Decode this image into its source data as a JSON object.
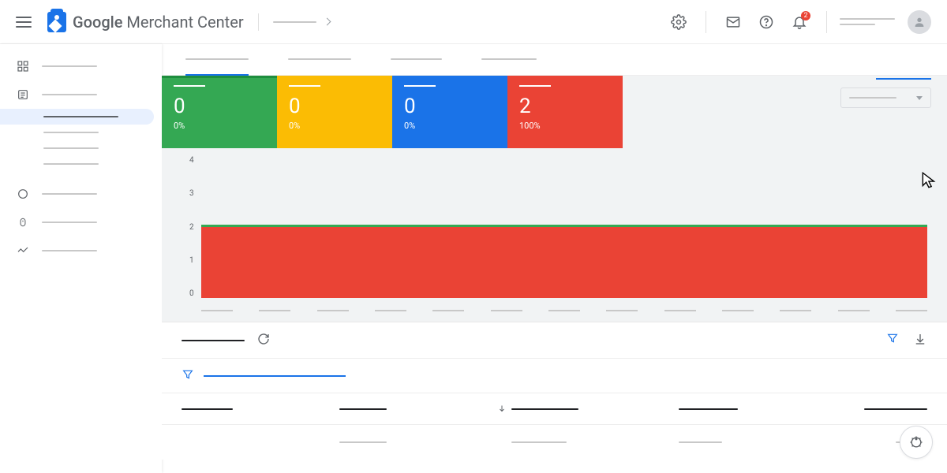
{
  "app_name_html": "Google <span style='font-weight:300'>Merchant Center</span>",
  "header": {
    "notification_count": "2"
  },
  "stats": [
    {
      "value": "0",
      "pct": "0%"
    },
    {
      "value": "0",
      "pct": "0%"
    },
    {
      "value": "0",
      "pct": "0%"
    },
    {
      "value": "2",
      "pct": "100%"
    }
  ],
  "chart_data": {
    "type": "area",
    "y_ticks": [
      "4",
      "3",
      "2",
      "1",
      "0"
    ],
    "ylim": [
      0,
      4
    ],
    "x_tick_count": 13,
    "series": [
      {
        "name": "red-area",
        "color": "#ea4335",
        "constant_value": 2
      },
      {
        "name": "green-line",
        "color": "#34a853",
        "constant_value": 2
      }
    ],
    "note": "Red area fills from y=0 to y=2 across all x; green line sits at y=2. X-axis category labels are redacted in the screenshot."
  }
}
